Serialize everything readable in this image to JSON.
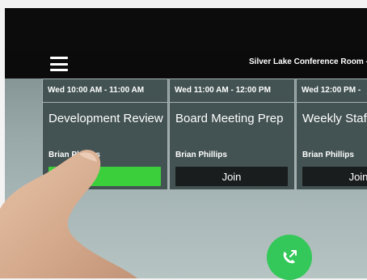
{
  "header": {
    "menu_icon": "hamburger-menu-icon",
    "room_name": "Silver Lake Conference Room -"
  },
  "meetings": [
    {
      "time": "Wed 10:00 AM - 11:00 AM",
      "title": "Development Review",
      "organizer": "Brian Phillips",
      "join_label": "",
      "join_state": "active"
    },
    {
      "time": "Wed 11:00 AM - 12:00 PM",
      "title": "Board Meeting Prep",
      "organizer": "Brian Phillips",
      "join_label": "Join",
      "join_state": "default"
    },
    {
      "time": "Wed 12:00 PM -",
      "title": "Weekly Staff",
      "organizer": "Brian Phillips",
      "join_label": "Join",
      "join_state": "default"
    }
  ],
  "fab": {
    "icon": "phone-outgoing-icon"
  },
  "colors": {
    "card_bg": "#435252",
    "join_active": "#3ccf3c",
    "join_default": "#1a1d1e",
    "fab_green": "#34c759"
  }
}
